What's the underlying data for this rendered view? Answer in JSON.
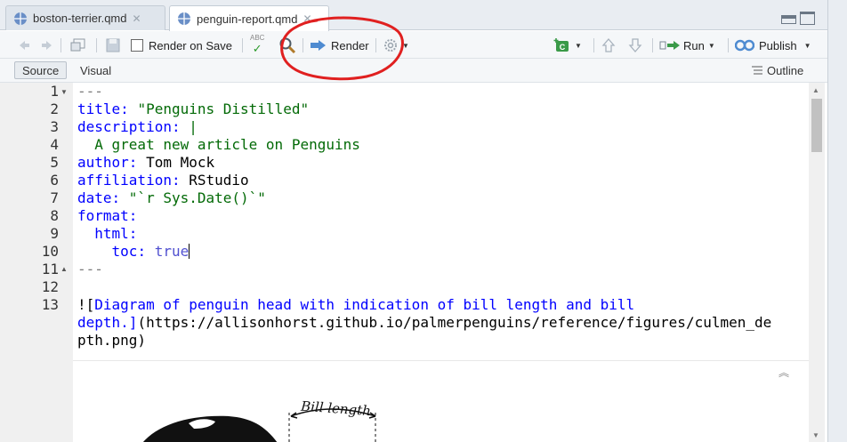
{
  "tabs": [
    {
      "label": "boston-terrier.qmd",
      "active": false
    },
    {
      "label": "penguin-report.qmd",
      "active": true
    }
  ],
  "toolbar": {
    "render_on_save": "Render on Save",
    "spell_label": "ABC",
    "render": "Render",
    "run": "Run",
    "publish": "Publish"
  },
  "modebar": {
    "source": "Source",
    "visual": "Visual",
    "outline": "Outline"
  },
  "editor": {
    "lines": [
      {
        "n": "1",
        "fold": "down"
      },
      {
        "n": "2"
      },
      {
        "n": "3"
      },
      {
        "n": "4"
      },
      {
        "n": "5"
      },
      {
        "n": "6"
      },
      {
        "n": "7"
      },
      {
        "n": "8"
      },
      {
        "n": "9"
      },
      {
        "n": "10"
      },
      {
        "n": "11",
        "fold": "up"
      },
      {
        "n": "12"
      },
      {
        "n": "13"
      }
    ],
    "code": {
      "l1": "---",
      "l2_key": "title",
      "l2_val": "\"Penguins Distilled\"",
      "l3_key": "description",
      "l3_val": "|",
      "l4": "  A great new article on Penguins",
      "l5_key": "author",
      "l5_val": "Tom Mock",
      "l6_key": "affiliation",
      "l6_val": "RStudio",
      "l7_key": "date",
      "l7_val": "\"`r Sys.Date()`\"",
      "l8_key": "format",
      "l9_key": "  html",
      "l10_key": "    toc",
      "l10_val": "true",
      "l11": "---",
      "l13a_bang": "![",
      "l13a_text": "Diagram of penguin head with indication of bill length and bill",
      "l13b_text": "depth.]",
      "l13b_rest": "(https://allisonhorst.github.io/palmerpenguins/reference/figures/culmen_de",
      "l13c": "pth.png)"
    },
    "image_label": "Bill length"
  },
  "colors": {
    "keyword": "#0000ff",
    "string": "#036a07",
    "annotation": "#e02020"
  }
}
